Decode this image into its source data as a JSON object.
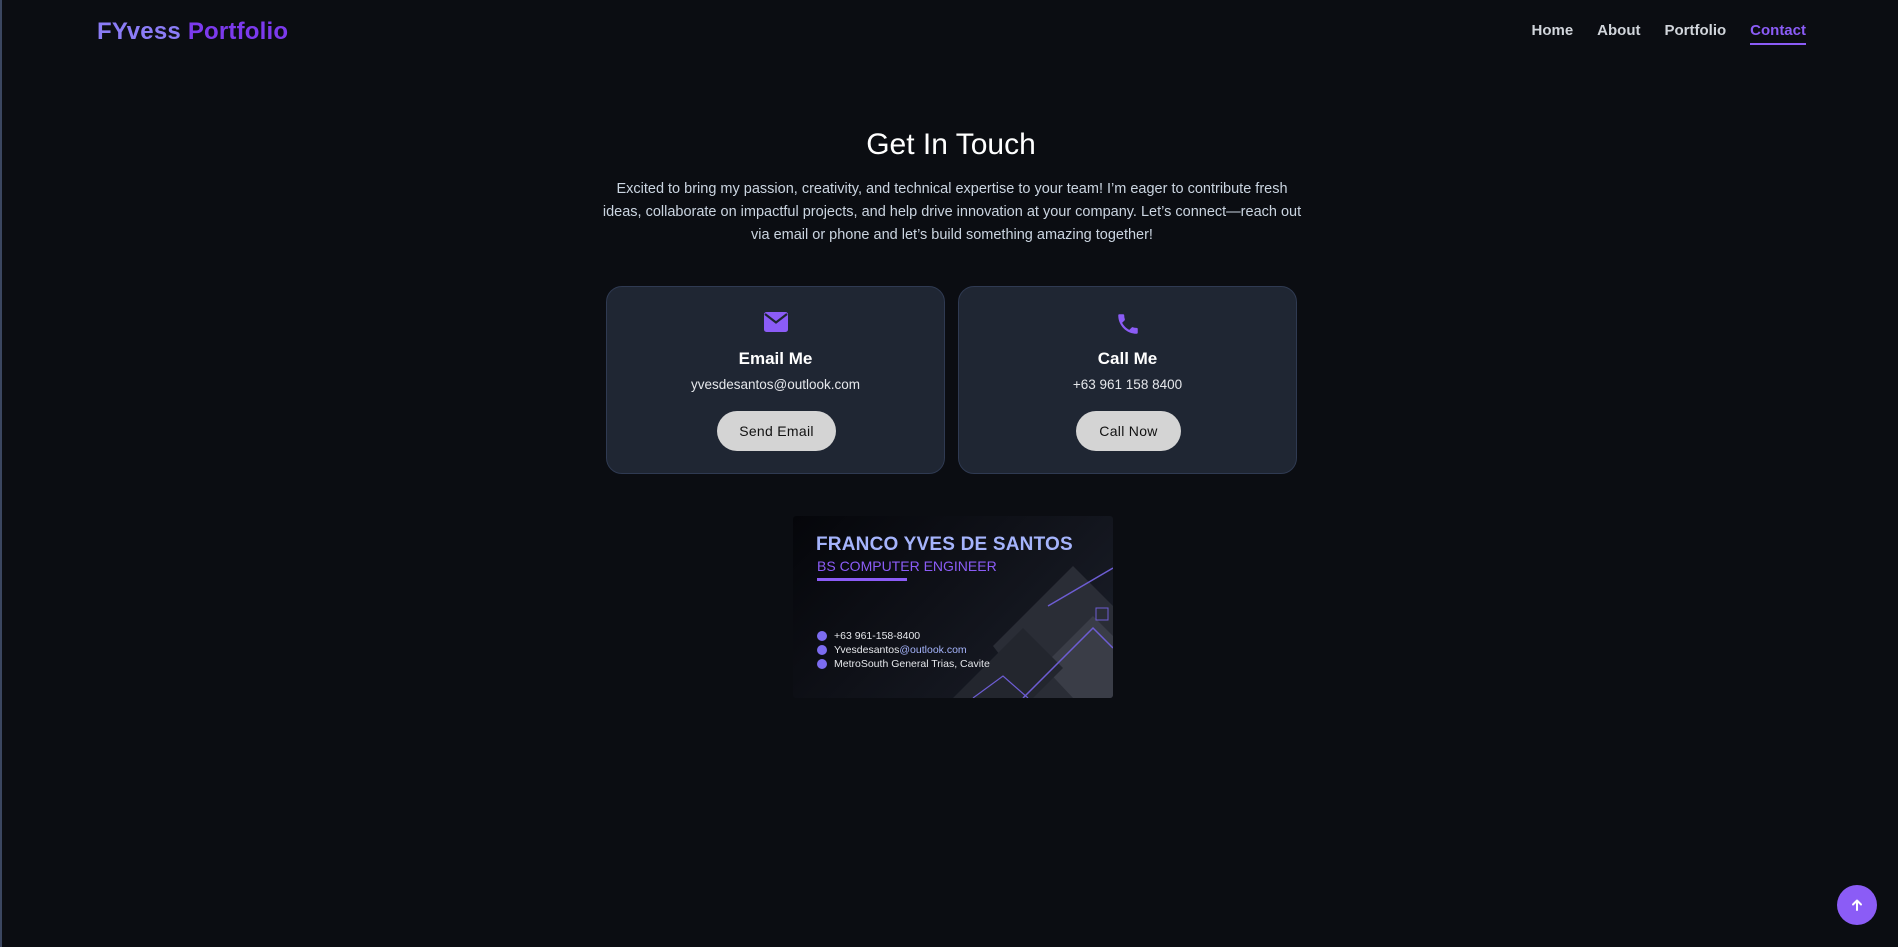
{
  "brand": {
    "part1": "FYvess",
    "part2": "Portfolio"
  },
  "nav": {
    "items": [
      {
        "label": "Home"
      },
      {
        "label": "About"
      },
      {
        "label": "Portfolio"
      },
      {
        "label": "Contact"
      }
    ],
    "active": "Contact"
  },
  "contact": {
    "heading": "Get In Touch",
    "intro": "Excited to bring my passion, creativity, and technical expertise to your team! I’m eager to contribute fresh ideas, collaborate on impactful projects, and help drive innovation at your company. Let’s connect—reach out via email or phone and let’s build something amazing together!",
    "email_card": {
      "icon": "envelope-icon",
      "title": "Email Me",
      "value": "yvesdesantos@outlook.com",
      "button": "Send Email"
    },
    "phone_card": {
      "icon": "phone-icon",
      "title": "Call Me",
      "value": "+63 961 158 8400",
      "button": "Call Now"
    }
  },
  "business_card": {
    "name": "FRANCO YVES DE SANTOS",
    "role": "BS COMPUTER ENGINEER",
    "phone": "+63 961-158-8400",
    "email_prefix": "Yvesdesantos",
    "email_domain": "@outlook.com",
    "address": "MetroSouth General Trias, Cavite"
  },
  "scroll_top": {
    "icon": "arrow-up-icon"
  },
  "colors": {
    "background": "#0b0d12",
    "accent": "#8b5cf6",
    "card_bg": "#1f2633",
    "button_bg": "#d4d4d4"
  }
}
